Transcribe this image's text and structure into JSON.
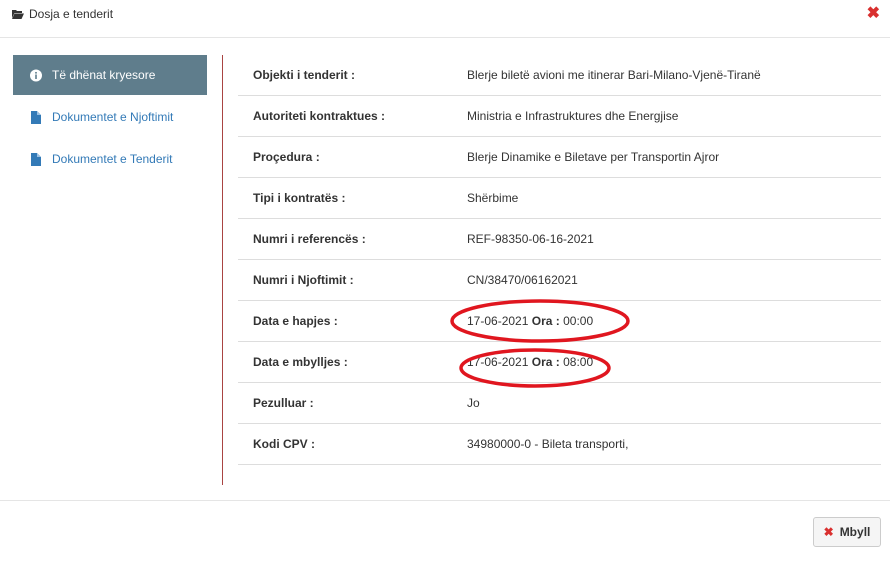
{
  "dialog": {
    "title": "Dosja e tenderit",
    "close_symbol": "✖"
  },
  "sidebar": {
    "items": [
      {
        "label": "Të dhënat kryesore",
        "icon": "info-circle-icon",
        "active": true
      },
      {
        "label": "Dokumentet e Njoftimit",
        "icon": "file-icon",
        "active": false
      },
      {
        "label": "Dokumentet e Tenderit",
        "icon": "file-icon",
        "active": false
      }
    ]
  },
  "details": {
    "rows": [
      {
        "label": "Objekti i tenderit :",
        "value": "Blerje biletë avioni me itinerar Bari-Milano-Vjenë-Tiranë"
      },
      {
        "label": "Autoriteti kontraktues :",
        "value": "Ministria e Infrastruktures dhe Energjise"
      },
      {
        "label": "Proçedura :",
        "value": "Blerje Dinamike e Biletave per Transportin Ajror"
      },
      {
        "label": "Tipi i kontratës :",
        "value": "Shërbime"
      },
      {
        "label": "Numri i referencës :",
        "value": "REF-98350-06-16-2021"
      },
      {
        "label": "Numri i Njoftimit :",
        "value": "CN/38470/06162021"
      },
      {
        "label": "Data e hapjes :",
        "date": "17-06-2021",
        "time_label": "Ora :",
        "time": "00:00"
      },
      {
        "label": "Data e mbylljes :",
        "date": "17-06-2021",
        "time_label": "Ora :",
        "time": "08:00"
      },
      {
        "label": "Pezulluar :",
        "value": "Jo"
      },
      {
        "label": "Kodi CPV :",
        "value": "34980000-0 - Bileta transporti,"
      }
    ]
  },
  "footer": {
    "close_button_label": "Mbyll",
    "close_button_symbol": "✖"
  },
  "colors": {
    "sidebar_active_bg": "#5f7d8c",
    "link": "#337ab7",
    "close_red": "#d9302f",
    "annotation_red": "#e0161f",
    "divider": "#a94442"
  }
}
